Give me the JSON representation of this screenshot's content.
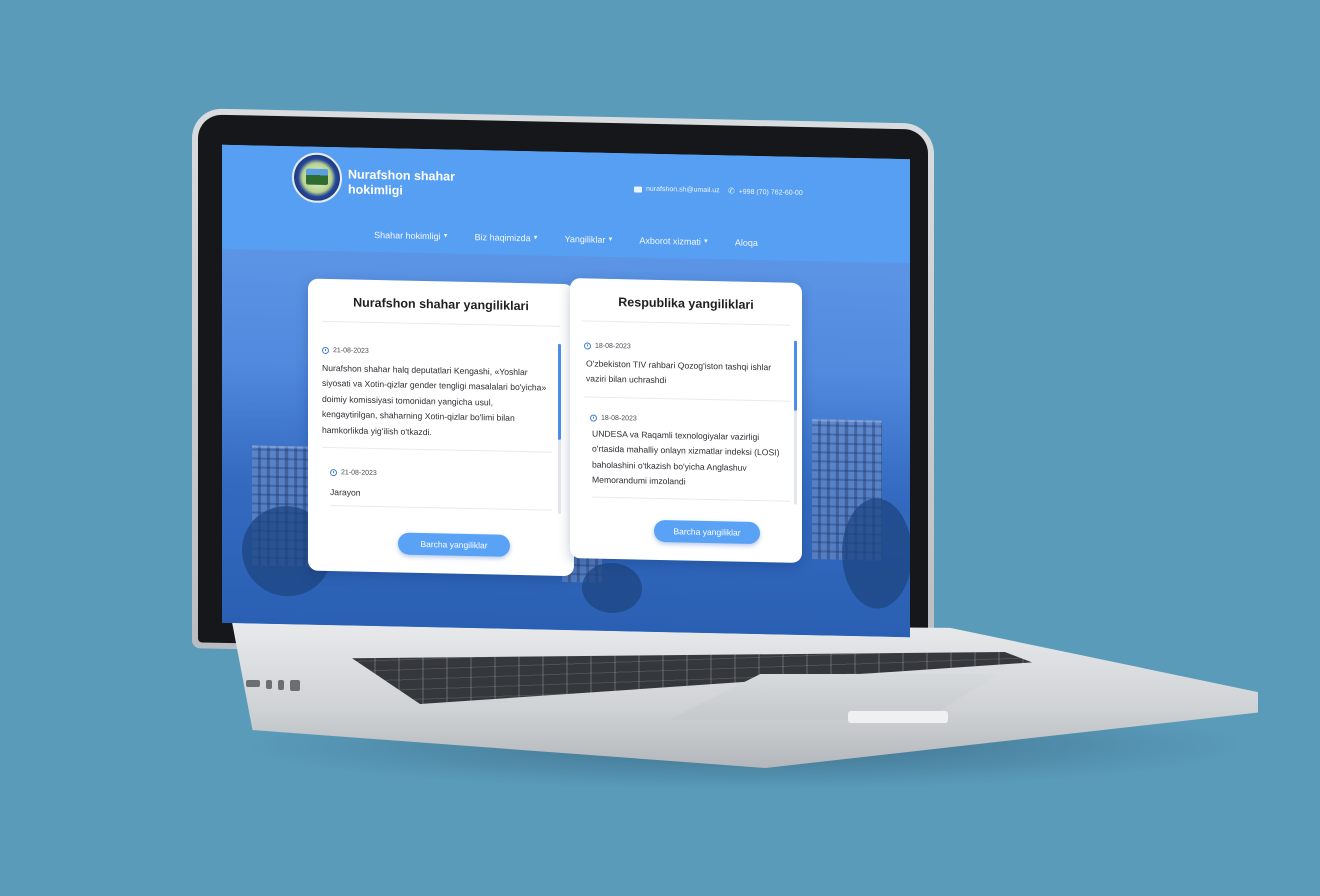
{
  "site": {
    "title": "Nurafshon shahar hokimligi",
    "email": "nurafshon.sh@umail.uz",
    "phone": "+998 (70) 762-60-00"
  },
  "nav": {
    "items": [
      {
        "label": "Shahar hokimligi",
        "dropdown": true
      },
      {
        "label": "Biz haqimizda",
        "dropdown": true
      },
      {
        "label": "Yangiliklar",
        "dropdown": true
      },
      {
        "label": "Axborot xizmati",
        "dropdown": true
      },
      {
        "label": "Aloqa",
        "dropdown": false
      }
    ]
  },
  "city_news": {
    "title": "Nurafshon shahar yangiliklari",
    "items": [
      {
        "date": "21-08-2023",
        "text": "Nurafshon shahar halq deputatlari Kengashi, «Yoshlar siyosati va Xotin-qizlar gender tengligi masalalari bo'yicha» doimiy komissiyasi tomonidan yangicha usul, kengaytirilgan, shaharning Xotin-qizlar bo'limi bilan hamkorlikda yig'ilish o'tkazdi."
      },
      {
        "date": "21-08-2023",
        "text": "Jarayon"
      }
    ],
    "button": "Barcha yangiliklar"
  },
  "republic_news": {
    "title": "Respublika yangiliklari",
    "items": [
      {
        "date": "18-08-2023",
        "text": "O'zbekiston TIV rahbari Qozog'iston tashqi ishlar vaziri bilan uchrashdi"
      },
      {
        "date": "18-08-2023",
        "text": "UNDESA va Raqamli texnologiyalar vazirligi o'rtasida mahalliy onlayn xizmatlar indeksi (LOSI) baholashini o'tkazish bo'yicha Anglashuv Memorandumi imzolandi"
      }
    ],
    "button": "Barcha yangiliklar"
  },
  "colors": {
    "header": "#579ff3",
    "accent": "#3d7fd9",
    "button": "#5aa2f5",
    "background": "#5a9bba"
  },
  "icons": [
    "envelope-icon",
    "phone-icon",
    "clock-icon",
    "caret-down-icon"
  ]
}
